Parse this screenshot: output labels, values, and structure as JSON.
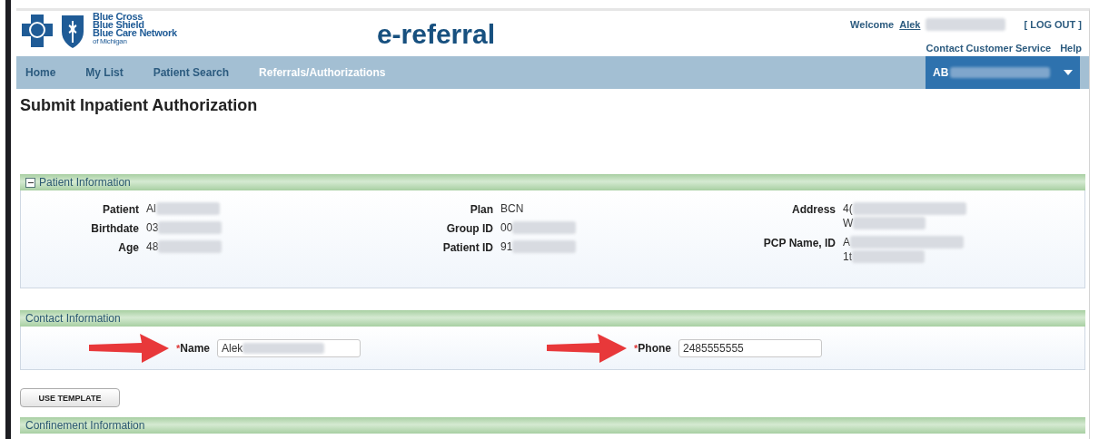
{
  "header": {
    "logo_lines": [
      "Blue Cross",
      "Blue Shield",
      "Blue Care Network",
      "of Michigan"
    ],
    "app_title": "e-referral",
    "welcome": "Welcome",
    "user_link": "Alek",
    "user_redacted": true,
    "logout": "[ LOG OUT ]",
    "links": [
      "Contact Customer Service",
      "Help"
    ]
  },
  "nav": {
    "items": [
      {
        "label": "Home",
        "selected": false
      },
      {
        "label": "My List",
        "selected": false
      },
      {
        "label": "Patient Search",
        "selected": false
      },
      {
        "label": "Referrals/Authorizations",
        "selected": true
      }
    ],
    "account": {
      "label": "AB",
      "redacted": true
    }
  },
  "page_title": "Submit Inpatient Authorization",
  "patient_section": {
    "title": "Patient Information",
    "expanded": true,
    "columns": [
      [
        {
          "label": "Patient",
          "lines": [
            "Al"
          ],
          "redacted": true
        },
        {
          "label": "Birthdate",
          "lines": [
            "03"
          ],
          "redacted": true
        },
        {
          "label": "Age",
          "lines": [
            "48"
          ],
          "redacted": true
        }
      ],
      [
        {
          "label": "Plan",
          "lines": [
            "BCN"
          ],
          "redacted": false
        },
        {
          "label": "Group ID",
          "lines": [
            "00"
          ],
          "redacted": true
        },
        {
          "label": "Patient ID",
          "lines": [
            "91"
          ],
          "redacted": true
        }
      ],
      [
        {
          "label": "Address",
          "lines": [
            "4(",
            "W"
          ],
          "redacted": true
        },
        {
          "label": "PCP Name, ID",
          "lines": [
            "A",
            "1t"
          ],
          "redacted": true
        }
      ]
    ]
  },
  "contact_section": {
    "title": "Contact Information",
    "fields": [
      {
        "marker": "*",
        "label": "Name",
        "value": "Alek",
        "redacted": true,
        "arrow": true
      },
      {
        "marker": "*",
        "label": "Phone",
        "value": "2485555555",
        "redacted": false,
        "arrow": true
      }
    ]
  },
  "template_button": "USE TEMPLATE",
  "confinement_section": {
    "title": "Confinement Information"
  }
}
